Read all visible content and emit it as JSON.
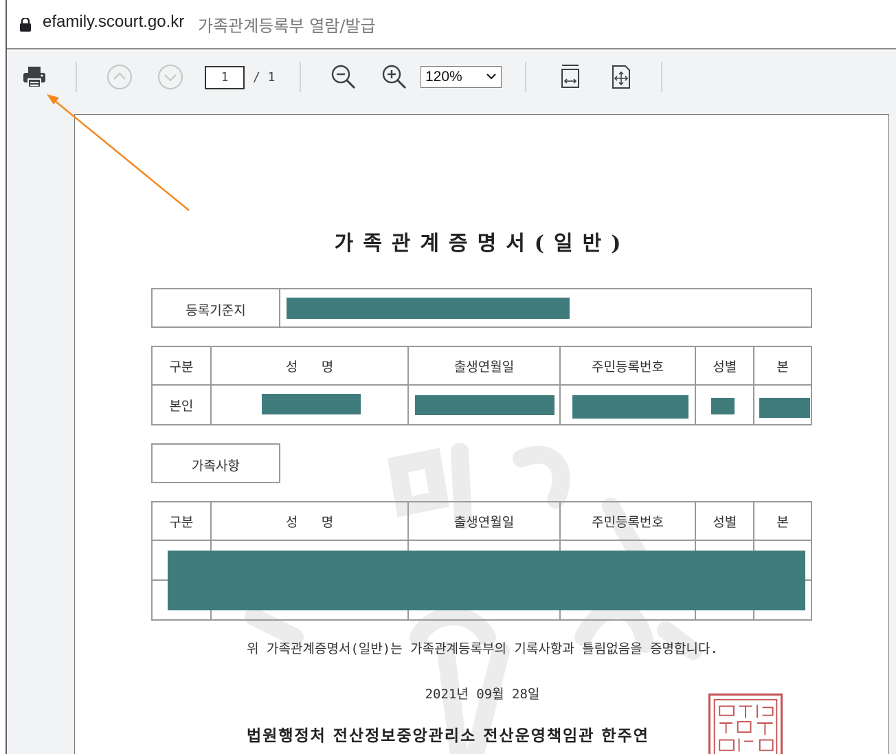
{
  "browser": {
    "url_host": "efamily.scourt.go.kr",
    "page_title": "가족관계등록부 열람/발급"
  },
  "pdf_toolbar": {
    "print_icon": "print-icon",
    "page_current": "1",
    "page_total": "/ 1",
    "zoom_value": "120%"
  },
  "document": {
    "title": "가족관계증명서(일반)",
    "registration_base_label": "등록기준지",
    "columns": [
      "구분",
      "성   명",
      "출생연월일",
      "주민등록번호",
      "성별",
      "본"
    ],
    "self_row_label": "본인",
    "family_section_label": "가족사항",
    "certification_text": "위 가족관계증명서(일반)는 가족관계등록부의 기록사항과 틀림없음을 증명합니다.",
    "issue_date": "2021년 09월 28일",
    "issuer": "법원행정처 전산정보중앙관리소 전산운영책임관 한주연"
  },
  "colors": {
    "redaction": "#417c7d",
    "annotation_arrow": "#f5871f",
    "seal": "#c45252"
  }
}
